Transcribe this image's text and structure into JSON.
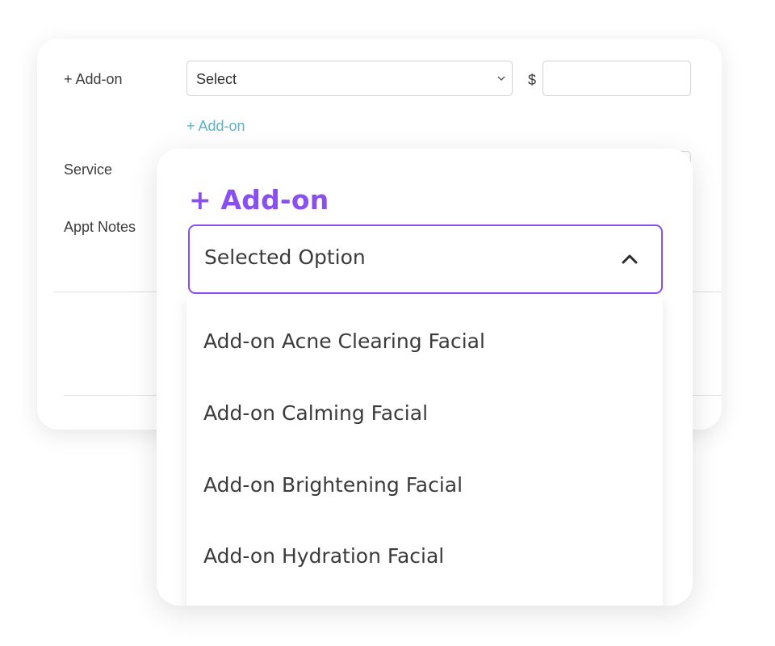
{
  "form": {
    "addon_label": "+ Add-on",
    "select_placeholder": "Select",
    "currency_symbol": "$",
    "price_value": "",
    "add_addon_link": "+ Add-on",
    "service_label": "Service",
    "notes_label": "Appt Notes"
  },
  "dropdown": {
    "title": "+ Add-on",
    "selected": "Selected Option",
    "options": [
      "Add-on Acne Clearing Facial",
      "Add-on Calming Facial",
      "Add-on Brightening Facial",
      "Add-on Hydration Facial"
    ]
  },
  "icons": {
    "select_chevron": "chevron-down-icon",
    "combo_chevron": "chevron-up-icon"
  },
  "colors": {
    "accent": "#8a4ff0",
    "link": "#56b4d0",
    "text": "#3b3b3b",
    "border": "#d2d2d2"
  }
}
